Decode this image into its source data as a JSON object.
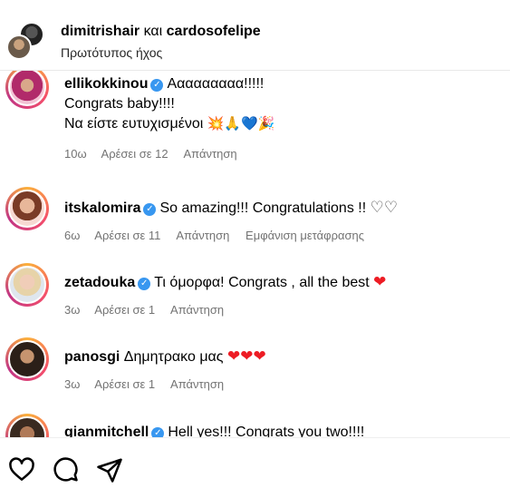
{
  "header": {
    "author1": "dimitrishair",
    "conjunction": "και",
    "author2": "cardosofelipe",
    "audio": "Πρωτότυπος ήχος"
  },
  "comments": [
    {
      "username": "ellikokkinou",
      "verified": true,
      "lines": [
        "Ααααααααα!!!!!",
        "Congrats baby!!!!",
        "Να είστε ευτυχισμένοι"
      ],
      "emojis": "💥🙏💙🎉",
      "time": "10ω",
      "likes": "Αρέσει σε 12",
      "reply": "Απάντηση"
    },
    {
      "username": "itskalomira",
      "verified": true,
      "text": "So amazing!!! Congratulations !!",
      "emojis": "♡♡",
      "time": "6ω",
      "likes": "Αρέσει σε 11",
      "reply": "Απάντηση",
      "translate": "Εμφάνιση μετάφρασης"
    },
    {
      "username": "zetadouka",
      "verified": true,
      "text": "Τι όμορφα! Congrats , all the best",
      "emojis": "❤",
      "time": "3ω",
      "likes": "Αρέσει σε 1",
      "reply": "Απάντηση"
    },
    {
      "username": "panosgi",
      "verified": false,
      "text": "Δημητρακο μας",
      "emojis": "❤❤❤",
      "time": "3ω",
      "likes": "Αρέσει σε 1",
      "reply": "Απάντηση"
    },
    {
      "username": "gianmitchell",
      "verified": true,
      "text": "Hell yes!!! Congrats you two!!!!"
    }
  ],
  "actions": {
    "like_icon": "heart-outline-icon",
    "comment_icon": "comment-bubble-icon",
    "share_icon": "paper-plane-icon"
  }
}
